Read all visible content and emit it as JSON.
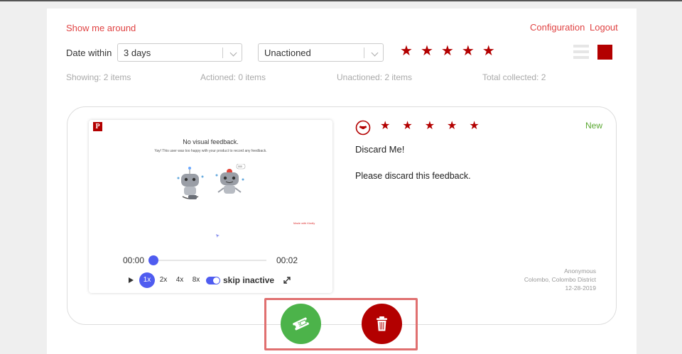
{
  "header": {
    "show_around": "Show me around",
    "configuration": "Configuration",
    "logout": "Logout"
  },
  "filters": {
    "date_label": "Date within",
    "date_value": "3 days",
    "status_value": "Unactioned",
    "rating_stars": 5
  },
  "stats": {
    "showing": "Showing: 2 items",
    "actioned": "Actioned: 0 items",
    "unactioned": "Unactioned: 2 items",
    "total": "Total collected: 2"
  },
  "card": {
    "player": {
      "logo": "P",
      "title": "No visual feedback.",
      "subtitle": "Yay! This user was too happy with your product to record any feedback.",
      "robot_bubble": "000",
      "tiny_text": "Made with Kindly",
      "time_start": "00:00",
      "time_end": "00:02",
      "progress": 0.0,
      "speeds": [
        "1x",
        "2x",
        "4x",
        "8x"
      ],
      "active_speed": "1x",
      "skip_label": "skip inactive"
    },
    "rating": 5,
    "status": "New",
    "title": "Discard Me!",
    "body": "Please discard this feedback.",
    "user": "Anonymous",
    "location": "Colombo, Colombo District",
    "date": "12-28-2019"
  },
  "colors": {
    "accent_red": "#b30000",
    "link_red": "#e04343",
    "green": "#4cb34a",
    "blue": "#4f5cf0"
  },
  "icons": {
    "ok_button": "ticket-icon",
    "delete_button": "trash-icon"
  }
}
